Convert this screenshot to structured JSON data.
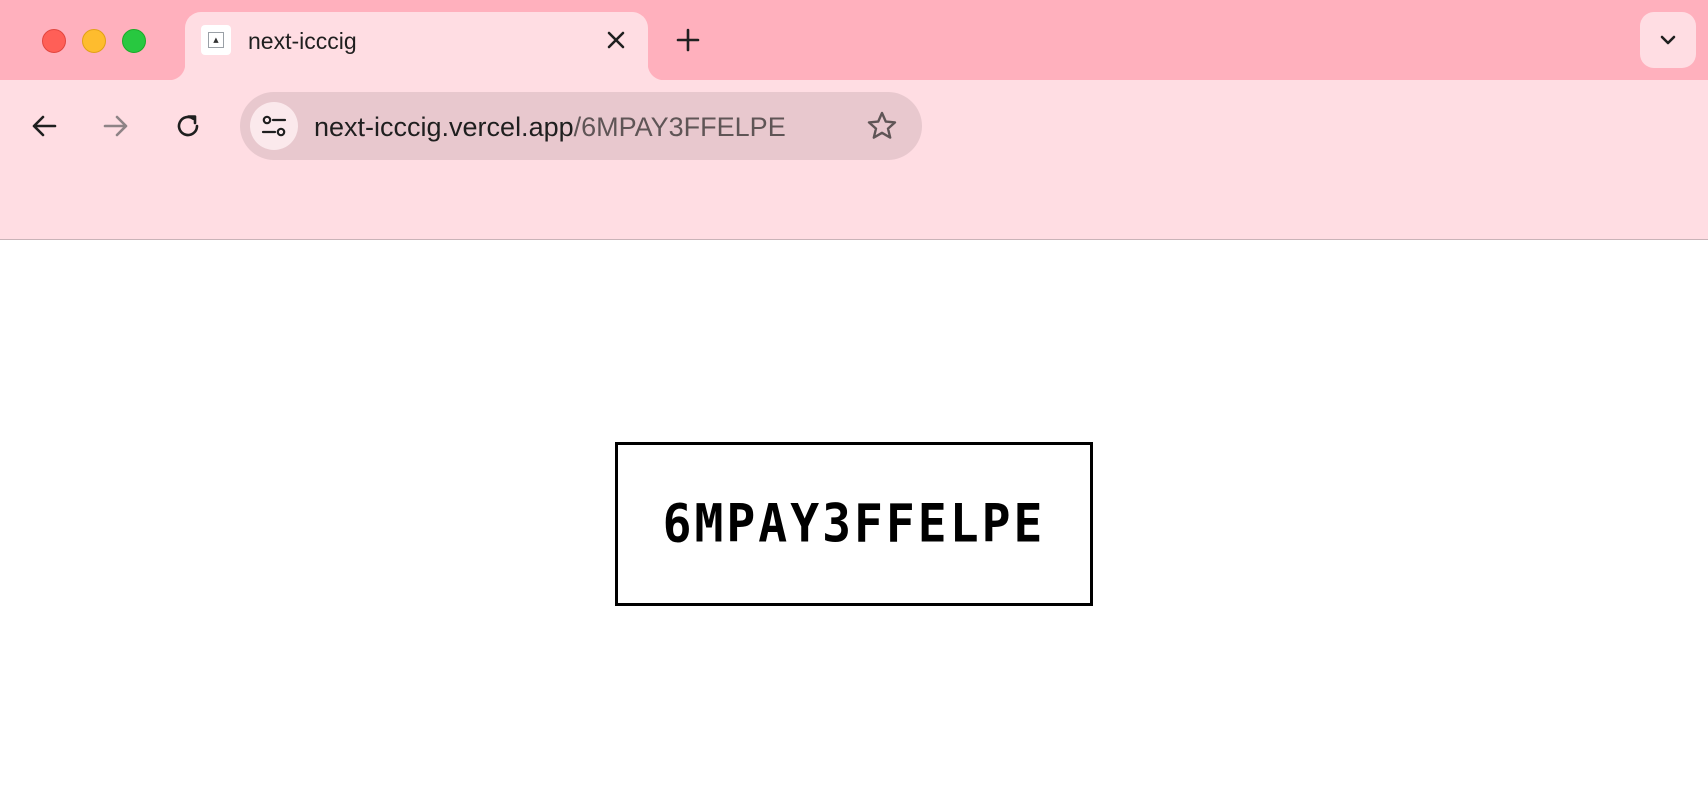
{
  "tab": {
    "title": "next-icccig"
  },
  "toolbar": {
    "url_host": "next-icccig.vercel.app",
    "url_path": "/6MPAY3FFELPE"
  },
  "content": {
    "captcha_text": "6MPAY3FFELPE"
  },
  "icons": {
    "close": "close-icon",
    "new_tab": "plus-icon",
    "tab_search": "chevron-down-icon",
    "back": "arrow-left-icon",
    "forward": "arrow-right-icon",
    "reload": "reload-icon",
    "site_info": "tune-icon",
    "bookmark": "star-icon"
  },
  "colors": {
    "tabstrip": "#ffb0bd",
    "toolbar": "#ffdde3",
    "omnibox": "#e8c8ce"
  }
}
